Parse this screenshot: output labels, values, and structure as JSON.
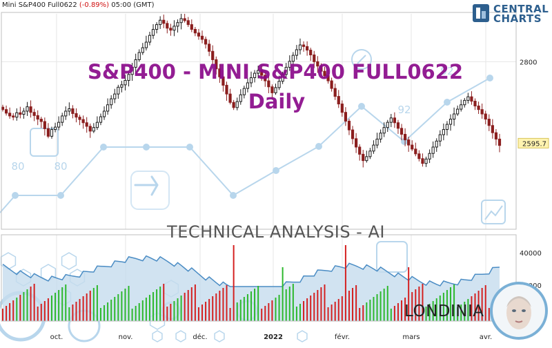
{
  "header": {
    "instrument": "Mini S&P400 Full0622",
    "change": "(-0.89%)",
    "time": "05:00 (GMT)"
  },
  "brand": {
    "line1": "CENTRAL",
    "line2": "CHARTS"
  },
  "title": {
    "line1": "S&P400 - MINI S&P400 FULL0622",
    "line2": "Daily"
  },
  "watermark_text": "TECHNICAL  ANALYSIS - AI",
  "logo_text": "LONDINIA",
  "background_numbers": [
    "80",
    "80",
    "92",
    "92"
  ],
  "colors": {
    "up": "#1a1a1a",
    "down": "#8b1e1e",
    "vol_up": "#2db82d",
    "vol_down": "#d42020",
    "area": "#c5dced",
    "area_line": "#4a8cc4",
    "watermark": "#b8d6ec",
    "title": "#8a0a8a"
  },
  "chart_data": [
    {
      "type": "candlestick",
      "title": "",
      "x_ticks": [
        "oct.",
        "nov.",
        "déc.",
        "2022",
        "févr.",
        "mars",
        "avr."
      ],
      "y_ticks": [
        2800
      ],
      "last_price": "2595.7",
      "last_value": 2595.7,
      "ylim": [
        2380,
        2920
      ],
      "grid": true,
      "candles_close": [
        2680,
        2671,
        2664,
        2661,
        2672,
        2668,
        2676,
        2687,
        2673,
        2665,
        2656,
        2650,
        2632,
        2613,
        2630,
        2636,
        2648,
        2664,
        2676,
        2682,
        2670,
        2661,
        2655,
        2647,
        2638,
        2626,
        2635,
        2648,
        2662,
        2676,
        2692,
        2707,
        2719,
        2736,
        2742,
        2753,
        2768,
        2786,
        2805,
        2823,
        2835,
        2849,
        2866,
        2881,
        2893,
        2904,
        2896,
        2884,
        2879,
        2889,
        2898,
        2908,
        2903,
        2893,
        2881,
        2872,
        2864,
        2856,
        2844,
        2826,
        2805,
        2782,
        2762,
        2741,
        2719,
        2698,
        2685,
        2700,
        2717,
        2733,
        2747,
        2760,
        2771,
        2778,
        2766,
        2752,
        2737,
        2722,
        2735,
        2751,
        2768,
        2786,
        2801,
        2816,
        2830,
        2842,
        2838,
        2829,
        2817,
        2800,
        2789,
        2776,
        2765,
        2752,
        2733,
        2713,
        2694,
        2673,
        2651,
        2629,
        2607,
        2586,
        2568,
        2552,
        2562,
        2576,
        2591,
        2606,
        2621,
        2635,
        2648,
        2659,
        2647,
        2633,
        2618,
        2604,
        2591,
        2581,
        2569,
        2557,
        2545,
        2556,
        2570,
        2586,
        2601,
        2617,
        2630,
        2643,
        2656,
        2669,
        2681,
        2692,
        2703,
        2712,
        2701,
        2689,
        2680,
        2669,
        2656,
        2640,
        2622,
        2606,
        2590
      ],
      "volume_area": "cumulative-volume line/area ranging 80% to 95% of pane height",
      "volume_axis_ticks": [
        40000,
        20000
      ]
    }
  ]
}
